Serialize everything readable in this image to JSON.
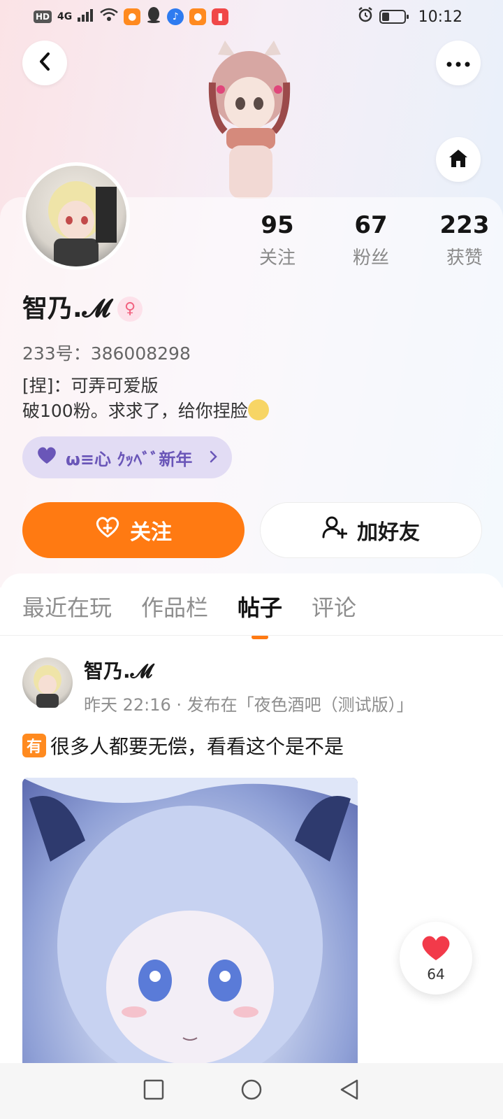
{
  "status_bar": {
    "left_indicators": [
      "HD",
      "4G"
    ],
    "time": "10:12"
  },
  "header": {
    "back_icon": "chevron-left-icon",
    "more_icon": "more-dots-icon",
    "home_icon": "home-icon"
  },
  "profile": {
    "stats": [
      {
        "value": "95",
        "label": "关注"
      },
      {
        "value": "67",
        "label": "粉丝"
      },
      {
        "value": "223",
        "label": "获赞"
      }
    ],
    "username": "智乃.𝓜",
    "gender_symbol": "♀",
    "id_line": "233号：386008298",
    "bio": "[捏]：可弄可爱版\n破100粉。求求了，给你捏脸",
    "tag_text": "ω≡心 ｸｯﾍﾞﾞ新年",
    "follow_label": "关注",
    "add_friend_label": "加好友"
  },
  "tabs": [
    {
      "label": "最近在玩",
      "active": false
    },
    {
      "label": "作品栏",
      "active": false
    },
    {
      "label": "帖子",
      "active": true
    },
    {
      "label": "评论",
      "active": false
    }
  ],
  "post": {
    "author": "智乃.𝓜",
    "meta": "昨天 22:16 · 发布在「夜色酒吧（测试版）」",
    "badge": "有",
    "text": "很多人都要无偿，看看这个是不是"
  },
  "like": {
    "count": "64"
  },
  "colors": {
    "accent": "#ff7a12",
    "like": "#f23a4a",
    "tag_bg": "#e2dcf4"
  }
}
